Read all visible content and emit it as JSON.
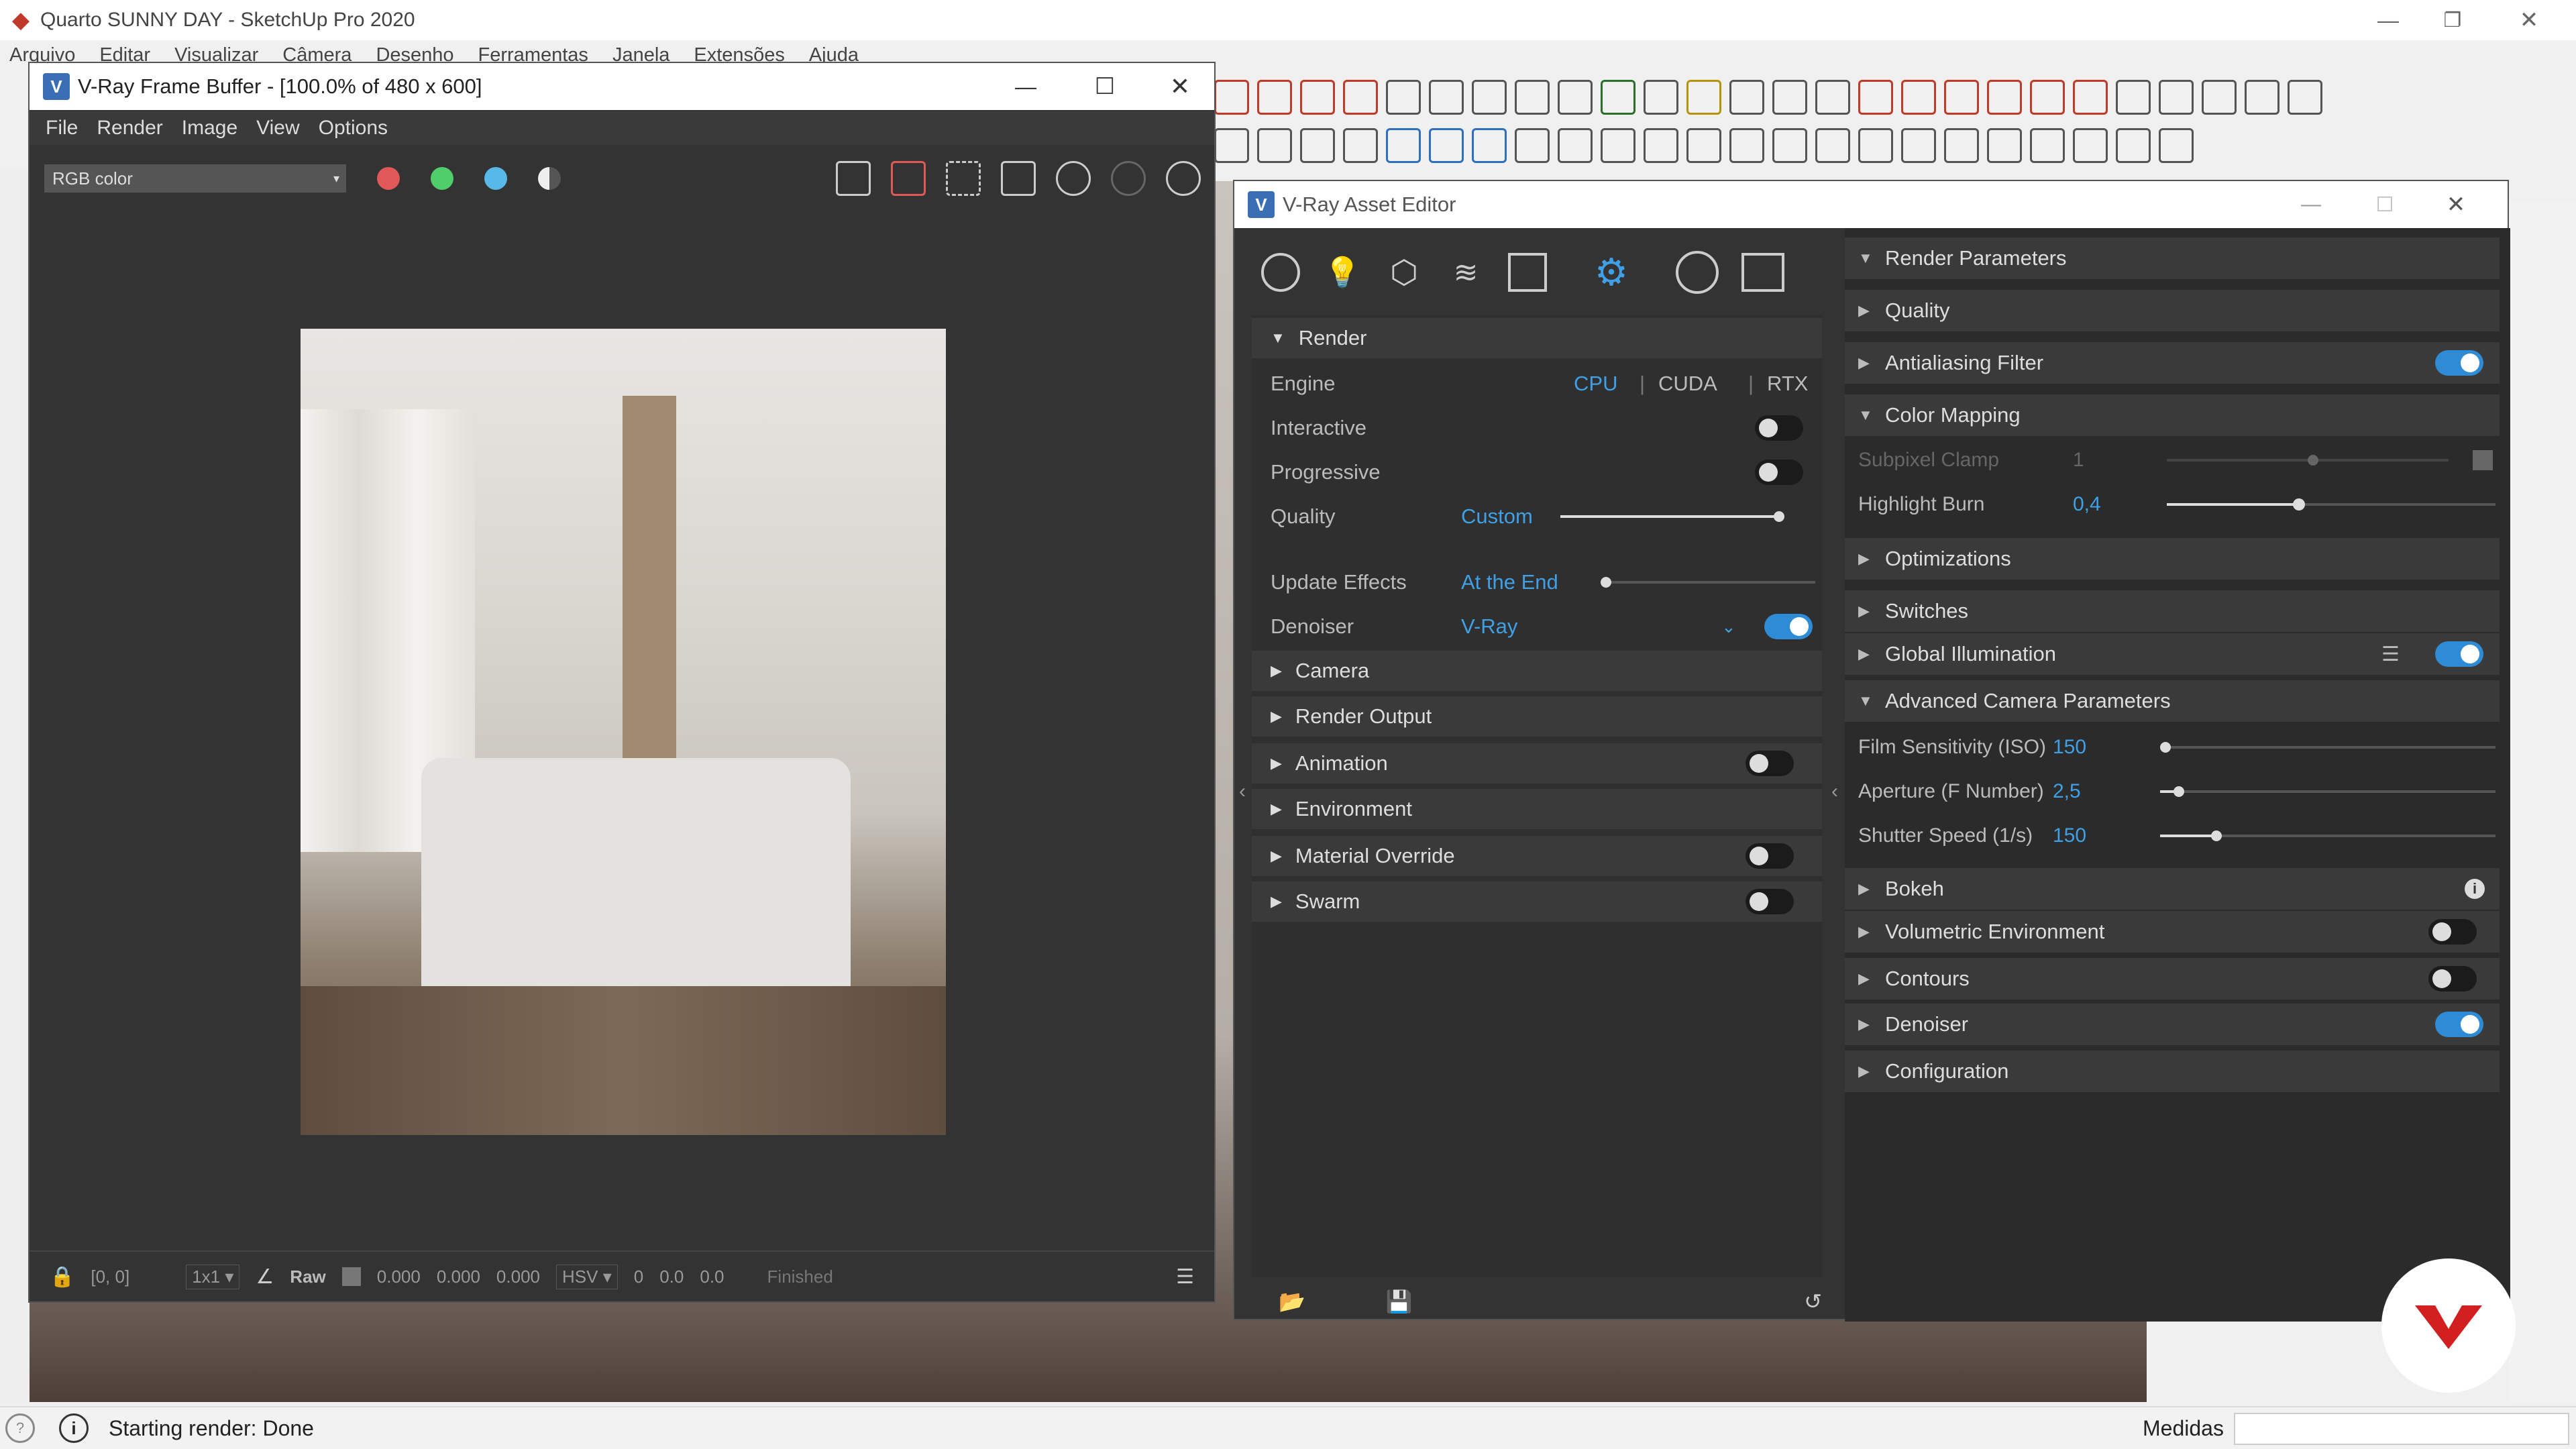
{
  "sketchup": {
    "title": "Quarto SUNNY DAY - SketchUp Pro 2020",
    "menu": [
      "Arquivo",
      "Editar",
      "Visualizar",
      "Câmera",
      "Desenho",
      "Ferramentas",
      "Janela",
      "Extensões",
      "Ajuda"
    ],
    "status": "Starting render: Done",
    "measures_label": "Medidas"
  },
  "vfb": {
    "title": "V-Ray Frame Buffer - [100.0% of 480 x 600]",
    "menu": [
      "File",
      "Render",
      "Image",
      "View",
      "Options"
    ],
    "channel": "RGB color",
    "status": {
      "coords": "[0, 0]",
      "zoom": "1x1",
      "raw": "Raw",
      "v1": "0.000",
      "v2": "0.000",
      "v3": "0.000",
      "mode": "HSV",
      "h": "0",
      "s": "0.0",
      "v": "0.0",
      "state": "Finished"
    }
  },
  "asset_editor": {
    "title": "V-Ray Asset Editor",
    "render": {
      "header": "Render",
      "engine_label": "Engine",
      "engines": [
        "CPU",
        "CUDA",
        "RTX"
      ],
      "interactive_label": "Interactive",
      "progressive_label": "Progressive",
      "quality_label": "Quality",
      "quality_value": "Custom",
      "quality_level": 1.0,
      "update_effects_label": "Update Effects",
      "update_effects_value": "At the End",
      "denoiser_label": "Denoiser",
      "denoiser_value": "V-Ray",
      "sections": [
        "Camera",
        "Render Output",
        "Animation",
        "Environment",
        "Material Override",
        "Swarm"
      ]
    },
    "params": {
      "header": "Render Parameters",
      "quality": "Quality",
      "antialiasing": "Antialiasing Filter",
      "color_mapping": "Color Mapping",
      "subpixel_label": "Subpixel Clamp",
      "subpixel_value": "1",
      "highlight_label": "Highlight Burn",
      "highlight_value": "0,4",
      "optimizations": "Optimizations",
      "switches": "Switches",
      "gi": "Global Illumination",
      "adv_camera": "Advanced Camera Parameters",
      "iso_label": "Film Sensitivity (ISO)",
      "iso_value": "150",
      "aperture_label": "Aperture (F Number)",
      "aperture_value": "2,5",
      "shutter_label": "Shutter Speed (1/s)",
      "shutter_value": "150",
      "bokeh": "Bokeh",
      "volumetric": "Volumetric Environment",
      "contours": "Contours",
      "denoiser": "Denoiser",
      "configuration": "Configuration"
    }
  }
}
